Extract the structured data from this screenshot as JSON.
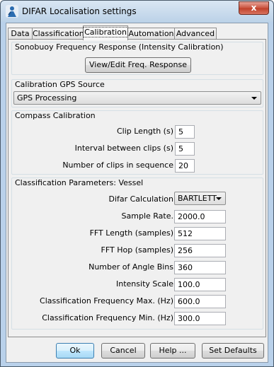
{
  "window": {
    "title": "DIFAR Localisation settings",
    "close_glyph": "x",
    "icon": "app-person-icon"
  },
  "tabs": [
    {
      "label": "Data",
      "active": false
    },
    {
      "label": "Classification",
      "active": false
    },
    {
      "label": "Calibration",
      "active": true
    },
    {
      "label": "Automation",
      "active": false
    },
    {
      "label": "Advanced",
      "active": false
    }
  ],
  "sonobuoy": {
    "title": "Sonobuoy Frequency Response (Intensity Calibration)",
    "button_label": "View/Edit Freq. Response"
  },
  "gps_source": {
    "title": "Calibration GPS Source",
    "selected": "GPS Processing"
  },
  "compass": {
    "title": "Compass Calibration",
    "clip_length_label": "Clip Length (s)",
    "clip_length_value": "5",
    "interval_label": "Interval between clips (s)",
    "interval_value": "5",
    "num_clips_label": "Number of clips in sequence",
    "num_clips_value": "20"
  },
  "classification": {
    "title": "Classification Parameters: Vessel",
    "difar_calc_label": "Difar Calculation",
    "difar_calc_value": "BARTLETT",
    "sample_rate_label": "Sample Rate.",
    "sample_rate_value": "2000.0",
    "fft_length_label": "FFT Length (samples)",
    "fft_length_value": "512",
    "fft_hop_label": "FFT Hop (samples)",
    "fft_hop_value": "256",
    "angle_bins_label": "Number of Angle Bins",
    "angle_bins_value": "360",
    "intensity_label": "Intensity Scale",
    "intensity_value": "100.0",
    "freq_max_label": "Classification Frequency Max. (Hz)",
    "freq_max_value": "600.0",
    "freq_min_label": "Classification Frequency Min. (Hz)",
    "freq_min_value": "300.0"
  },
  "footer": {
    "ok_label": "Ok",
    "cancel_label": "Cancel",
    "help_label": "Help ...",
    "defaults_label": "Set Defaults"
  }
}
